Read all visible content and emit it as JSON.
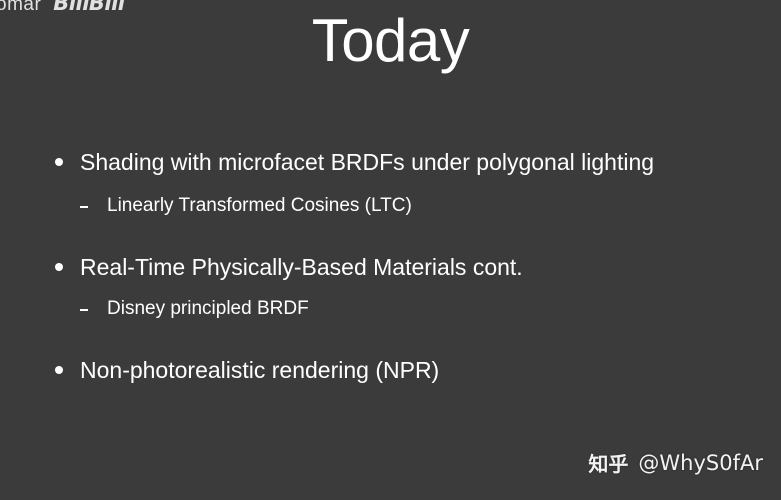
{
  "watermark_top_left": {
    "text_a": "omar",
    "text_b": "BiliBili"
  },
  "slide": {
    "title": "Today",
    "bullets": [
      {
        "text": "Shading with microfacet BRDFs under polygonal lighting",
        "sub": "Linearly Transformed Cosines (LTC)"
      },
      {
        "text": "Real-Time Physically-Based Materials cont.",
        "sub": "Disney principled BRDF"
      },
      {
        "text": "Non-photorealistic rendering (NPR)"
      }
    ]
  },
  "watermark_bottom_right": {
    "site": "知乎",
    "handle": "@WhyS0fAr"
  },
  "colors": {
    "background": "#3b3b3b",
    "text": "#ffffff"
  }
}
